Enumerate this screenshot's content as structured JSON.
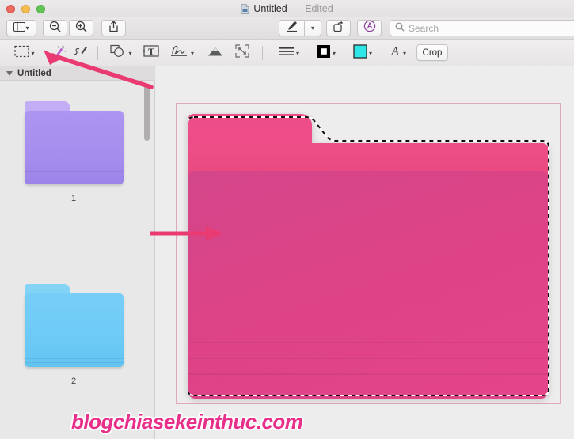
{
  "window": {
    "title": "Untitled",
    "title_separator": "—",
    "status": "Edited",
    "doc_icon": "document-icon"
  },
  "traffic_lights": {
    "close": "close-button",
    "minimize": "minimize-button",
    "zoom": "maximize-button",
    "colors": {
      "close": "#ee6a5e",
      "minimize": "#f5bd4f",
      "zoom": "#61c454"
    }
  },
  "toolbar": {
    "sidebar_label": "sidebar-toggle",
    "zoom_out_label": "zoom-out",
    "zoom_in_label": "zoom-in",
    "share_label": "share",
    "markup_label": "markup-toolbar-toggle",
    "rotate_label": "rotate-left",
    "annotate_label": "annotate",
    "search": {
      "placeholder": "Search",
      "value": ""
    }
  },
  "markup_toolbar": {
    "tools": [
      {
        "name": "selection-tool",
        "icon": "dashed-rectangle-icon",
        "has_chevron": true
      },
      {
        "name": "instant-alpha-tool",
        "icon": "magic-wand-icon",
        "has_chevron": false
      },
      {
        "name": "sketch-tool",
        "icon": "sketch-icon",
        "has_chevron": false
      },
      {
        "name": "shapes-tool",
        "icon": "shapes-icon",
        "has_chevron": true
      },
      {
        "name": "text-tool",
        "icon": "text-box-icon",
        "has_chevron": false
      },
      {
        "name": "signature-tool",
        "icon": "signature-icon",
        "has_chevron": true
      },
      {
        "name": "adjust-color-tool",
        "icon": "adjust-color-icon",
        "has_chevron": false
      },
      {
        "name": "adjust-size-tool",
        "icon": "adjust-size-icon",
        "has_chevron": false
      },
      {
        "name": "shape-style-tool",
        "icon": "line-style-icon",
        "has_chevron": true
      },
      {
        "name": "border-color-tool",
        "icon": "border-color-swatch-icon",
        "has_chevron": true
      },
      {
        "name": "fill-color-tool",
        "icon": "fill-color-swatch-icon",
        "has_chevron": true
      },
      {
        "name": "text-style-tool",
        "icon": "font-style-icon",
        "has_chevron": true
      }
    ],
    "border_color": "#000000",
    "fill_color": "#2ee6e6",
    "crop_label": "Crop"
  },
  "sidebar": {
    "header_title": "Untitled",
    "thumbnails": [
      {
        "label": "1",
        "kind": "folder-thumbnail",
        "tab_color": "#c3aef5",
        "body_top": "#a78fee",
        "body_bottom": "#9b83e8"
      },
      {
        "label": "2",
        "kind": "folder-thumbnail",
        "tab_color": "#83d3f7",
        "body_top": "#6ecdf7",
        "body_bottom": "#62c4f2"
      }
    ]
  },
  "canvas": {
    "image_name": "pink-folder-image",
    "selection": "marching-ants-selection",
    "border_color": "#e0a8bd",
    "folder_tab_color": "#ef4f88",
    "folder_body_color": "#d4468a"
  },
  "annotations": {
    "arrow_color": "#ea3a72",
    "arrows": [
      {
        "name": "arrow-to-instant-alpha",
        "points_to": "instant-alpha-tool"
      },
      {
        "name": "arrow-to-selected-image",
        "points_to": "pink-folder-image"
      }
    ]
  },
  "watermark": {
    "text": "blogchiasekeinthuc.com",
    "color": "#e8308a"
  }
}
